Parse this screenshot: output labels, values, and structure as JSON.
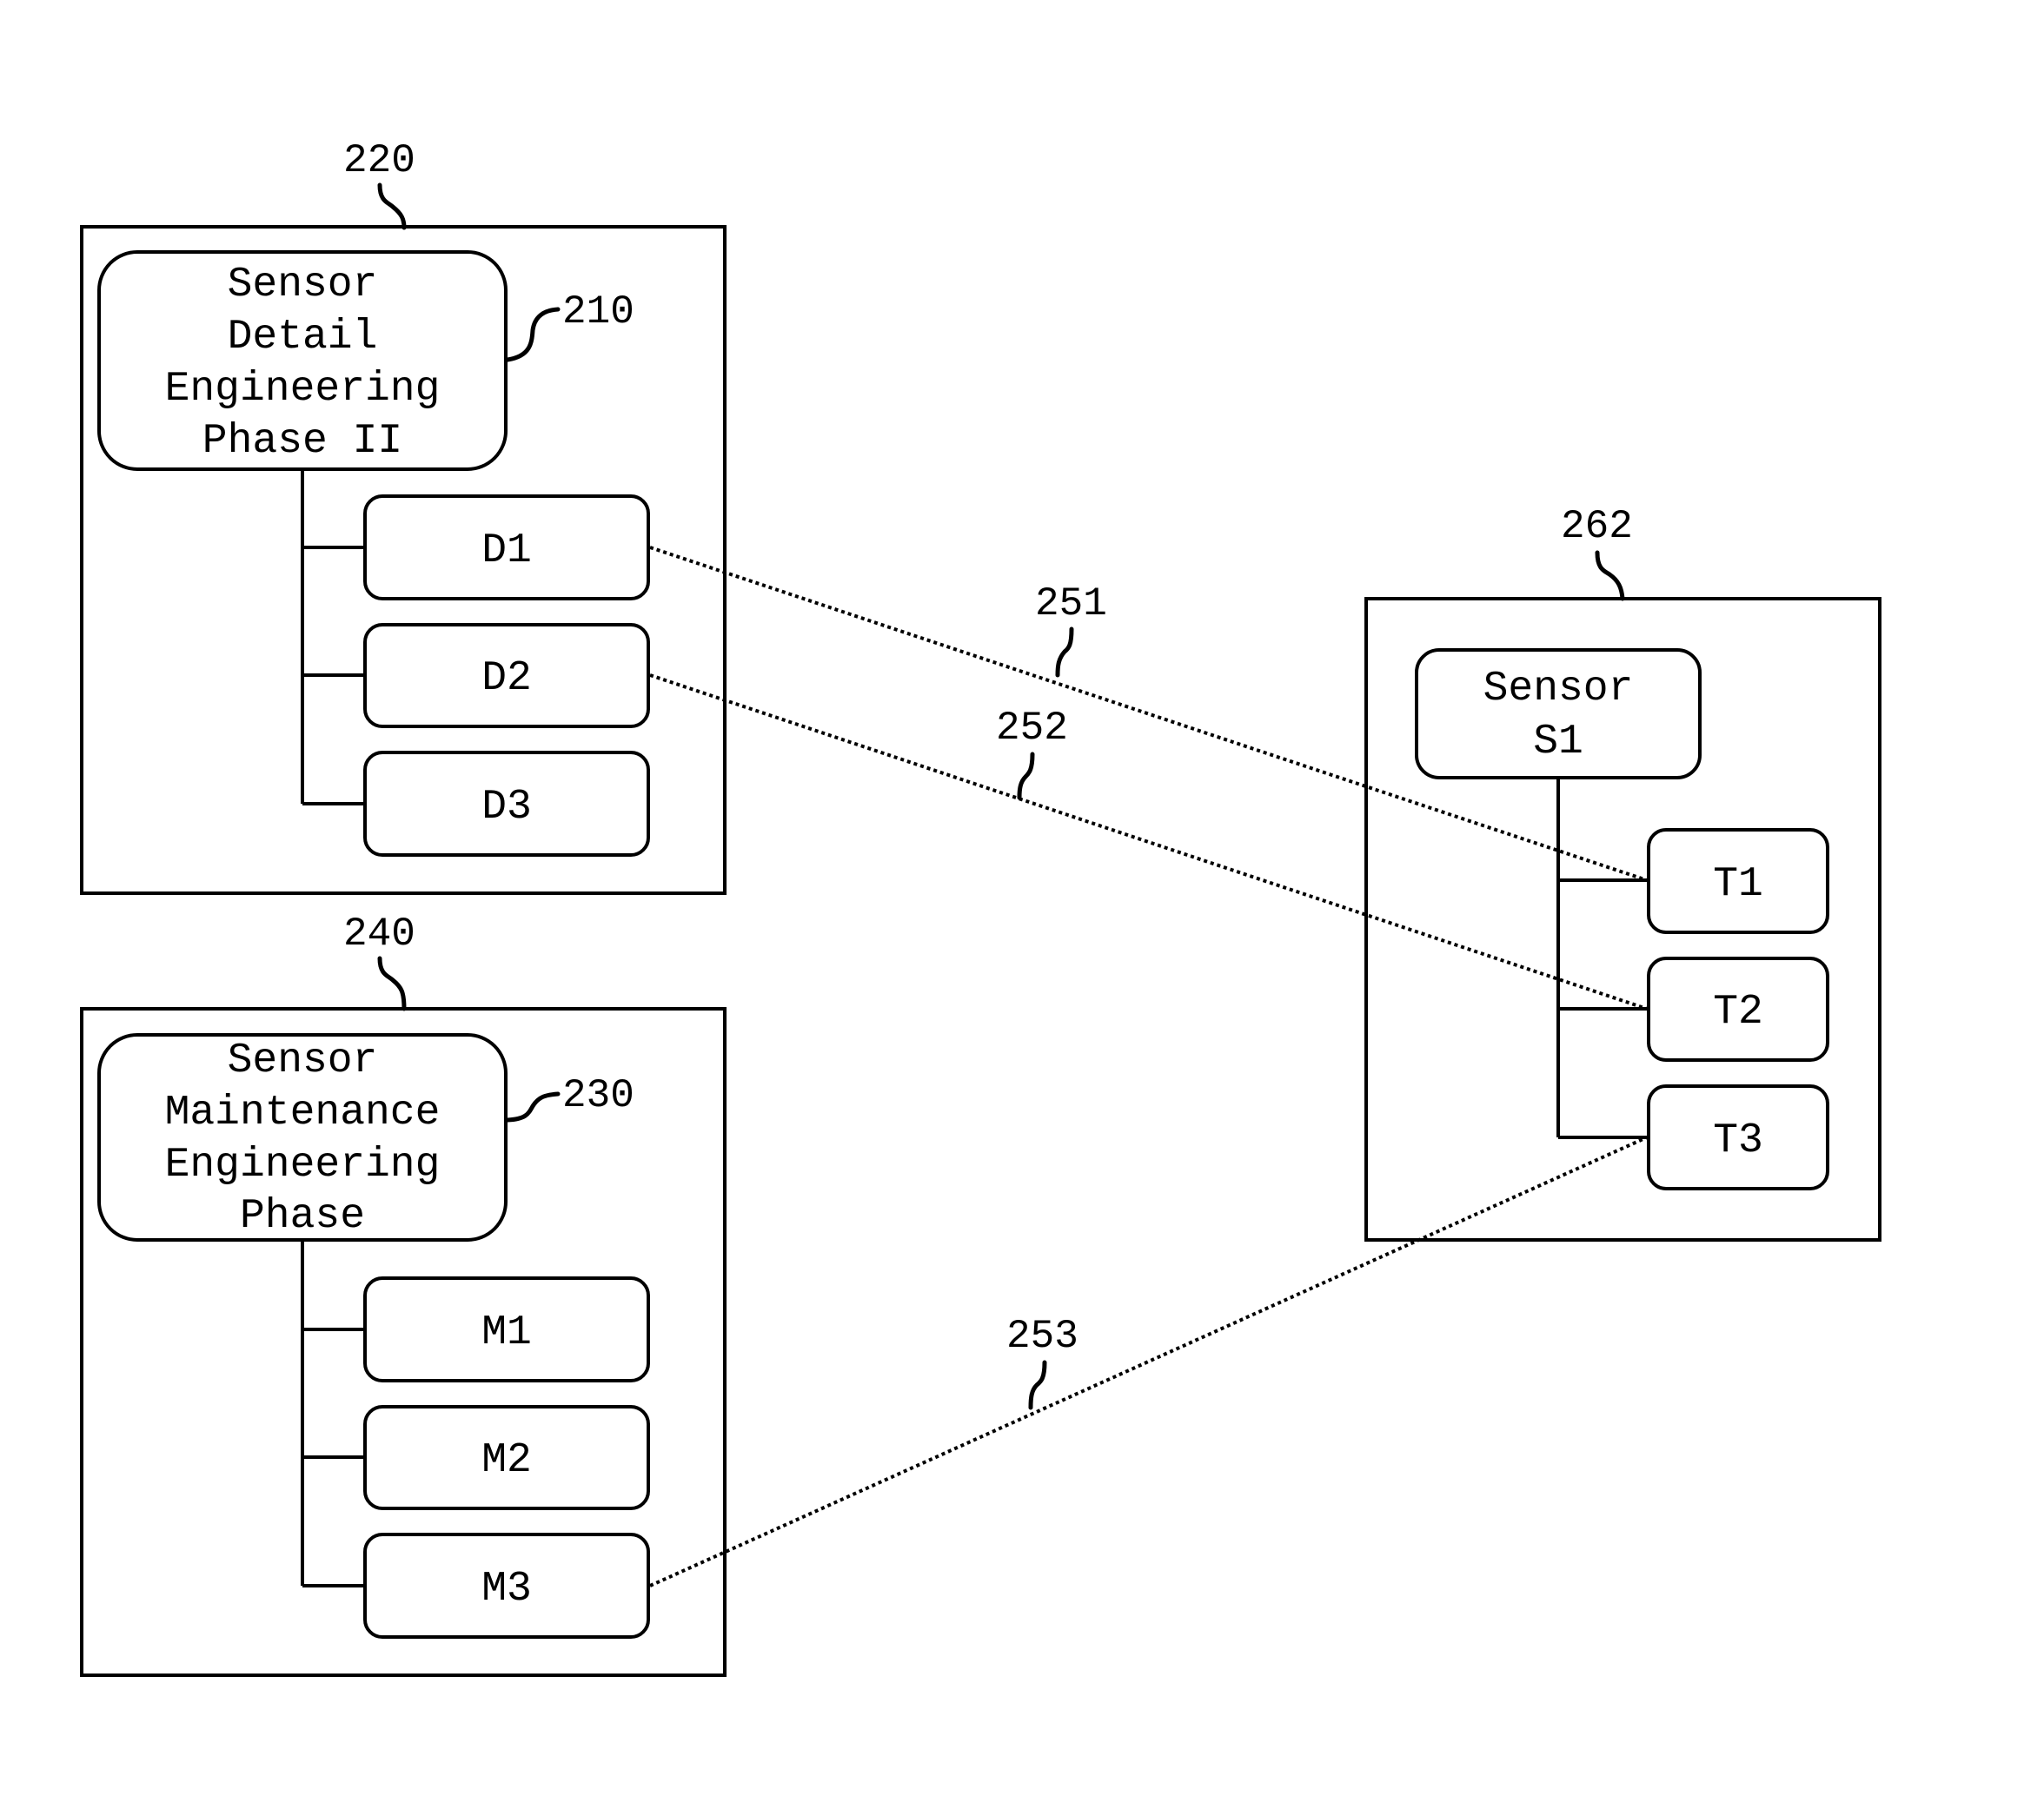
{
  "diagram": {
    "groups": [
      {
        "id": "phase-detail",
        "ref": "220",
        "header": {
          "ref": "210",
          "lines": [
            "Sensor",
            "Detail",
            "Engineering",
            "Phase II"
          ]
        },
        "items": [
          "D1",
          "D2",
          "D3"
        ]
      },
      {
        "id": "phase-maintenance",
        "ref": "240",
        "header": {
          "ref": "230",
          "lines": [
            "Sensor",
            "Maintenance",
            "Engineering",
            "Phase"
          ]
        },
        "items": [
          "M1",
          "M2",
          "M3"
        ]
      },
      {
        "id": "sensor",
        "ref": "262",
        "header": {
          "lines": [
            "Sensor",
            "S1"
          ]
        },
        "items": [
          "T1",
          "T2",
          "T3"
        ]
      }
    ],
    "links": [
      {
        "ref": "251",
        "from": "D1",
        "to": "T1",
        "style": "dotted"
      },
      {
        "ref": "252",
        "from": "D2",
        "to": "T2",
        "style": "dotted"
      },
      {
        "ref": "253",
        "from": "M3",
        "to": "T3",
        "style": "dotted"
      }
    ]
  }
}
